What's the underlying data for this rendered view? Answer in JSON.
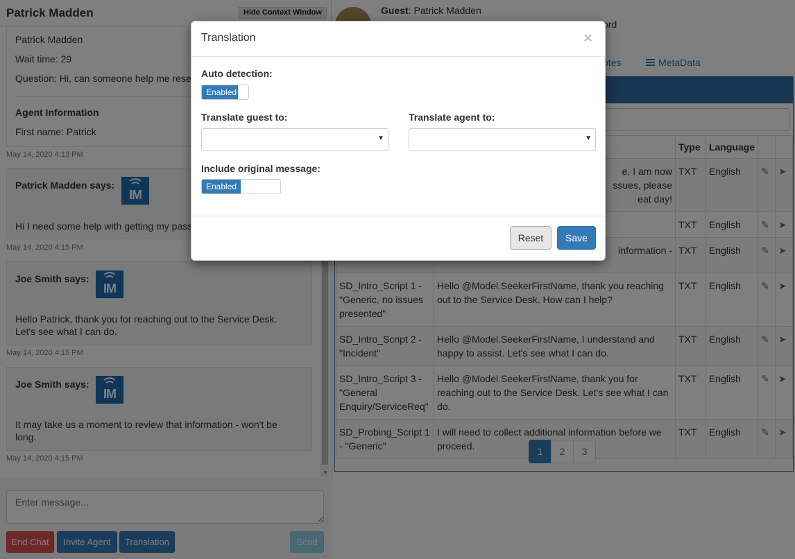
{
  "left": {
    "title": "Patrick Madden",
    "hide_context_label": "Hide Context Window",
    "context": {
      "name": "Patrick Madden",
      "wait_time": "Wait time: 29",
      "question": "Question: Hi, can someone help me reset",
      "agent_heading": "Agent Information",
      "first_name": "First name: Patrick",
      "timestamp": "May 14, 2020 4:13 PM"
    },
    "messages": [
      {
        "who": "Patrick Madden says:",
        "body": "Hi I need some help with getting my pass",
        "timestamp": "May 14, 2020 4:15 PM",
        "logo_text": "IM"
      },
      {
        "who": "Joe Smith says:",
        "body": "Hello Patrick, thank you for reaching out to the Service Desk. Let's see what I can do.",
        "timestamp": "May 14, 2020 4:15 PM",
        "logo_text": "IM"
      },
      {
        "who": "Joe Smith says:",
        "body": "It may take us a moment to review that information - won't be long.",
        "timestamp": "May 14, 2020 4:15 PM",
        "logo_text": "IM"
      }
    ],
    "input_placeholder": "Enter message...",
    "buttons": {
      "end_chat": "End Chat",
      "invite_agent": "Invite Agent",
      "translation": "Translation",
      "send": "Send"
    }
  },
  "right": {
    "guest_label": "Guest",
    "guest_name": ": Patrick Madden",
    "partial_word": "ord",
    "tab_notes": "otes",
    "tab_metadata": "MetaData",
    "table": {
      "headers": [
        "",
        "",
        "Type",
        "Language",
        "",
        ""
      ],
      "rows": [
        {
          "name": "",
          "text": "e. I am now\nssues, please\neat day!",
          "type": "TXT",
          "lang": "English"
        },
        {
          "name": "",
          "text": "",
          "type": "TXT",
          "lang": "English"
        },
        {
          "name": "",
          "text": "information -",
          "type": "TXT",
          "lang": "English"
        },
        {
          "name": "SD_Intro_Script 1 - \"Generic, no issues presented\"",
          "text": "Hello @Model.SeekerFirstName, thank you reaching out to the Service Desk. How can I help?",
          "type": "TXT",
          "lang": "English"
        },
        {
          "name": "SD_Intro_Script 2 - \"Incident\"",
          "text": "Hello @Model.SeekerFirstName, I understand and happy to assist. Let's see what I can do.",
          "type": "TXT",
          "lang": "English"
        },
        {
          "name": "SD_Intro_Script 3 - \"General Enquiry/ServiceReq\"",
          "text": "Hello @Model.SeekerFirstName, thank you for reaching out to the Service Desk. Let's see what I can do.",
          "type": "TXT",
          "lang": "English"
        },
        {
          "name": "SD_Probing_Script 1 - \"Generic\"",
          "text": "I will need to collect additional information before we proceed.",
          "type": "TXT",
          "lang": "English"
        }
      ]
    },
    "pagination": [
      "1",
      "2",
      "3"
    ],
    "active_page": "1"
  },
  "modal": {
    "title": "Translation",
    "close_glyph": "×",
    "auto_detection_label": "Auto detection:",
    "auto_detection_state": "Enabled",
    "translate_guest_label": "Translate guest to:",
    "translate_guest_value": "",
    "translate_agent_label": "Translate agent to:",
    "translate_agent_value": "",
    "include_original_label": "Include original message:",
    "include_original_state": "Enabled",
    "reset_label": "Reset",
    "save_label": "Save"
  },
  "colors": {
    "primary": "#337ab7",
    "danger": "#d9534f",
    "info": "#5bc0de",
    "panel_header": "#2e6da4"
  },
  "icons": {
    "edit": "edit-icon",
    "send": "paper-plane-icon",
    "metadata": "list-icon",
    "caret": "caret-down-icon"
  }
}
